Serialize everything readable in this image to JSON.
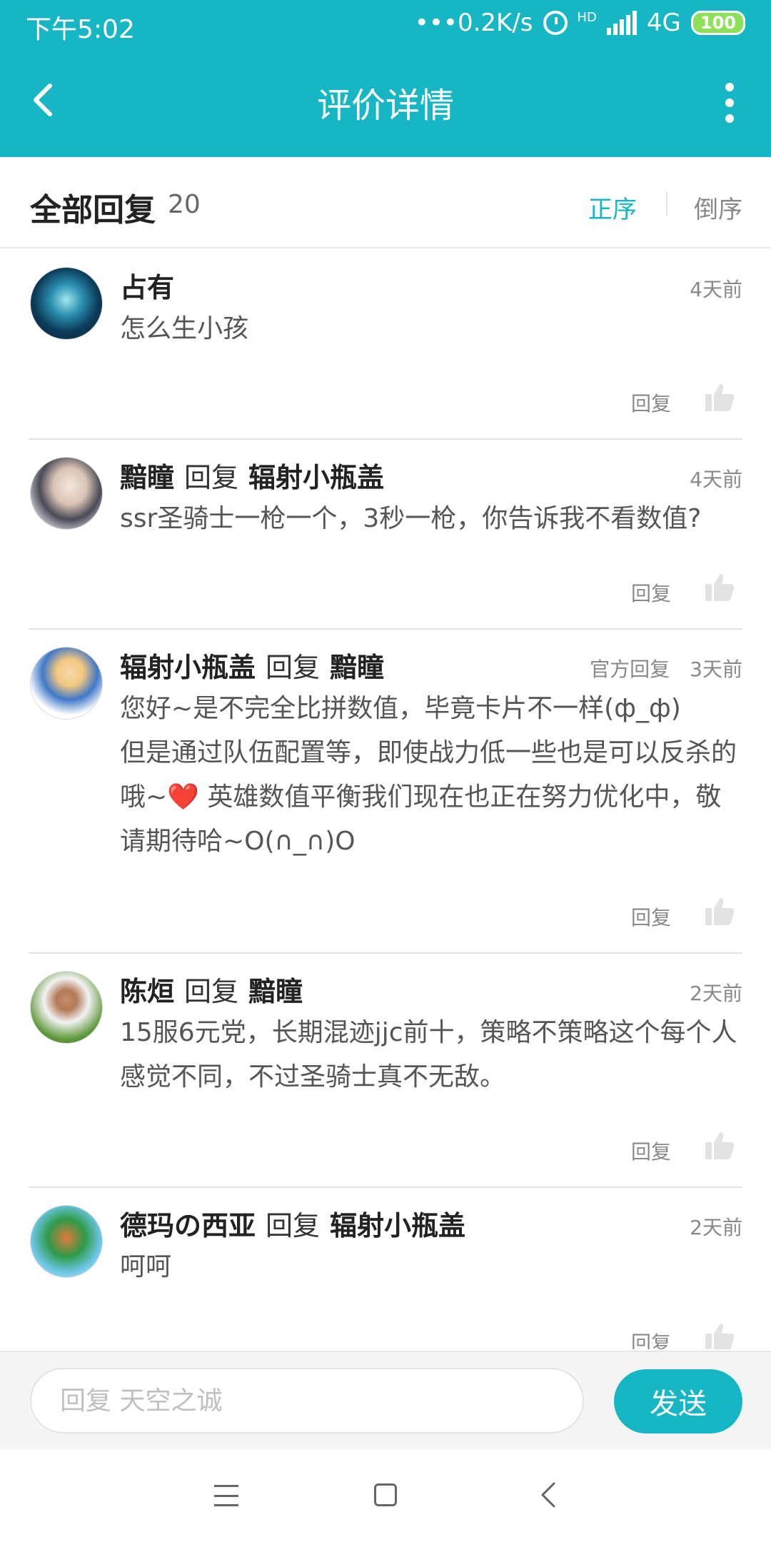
{
  "status_bar": {
    "time": "下午5:02",
    "network_speed": "•••0.2K/s",
    "hd_label": "HD",
    "network_type": "4G",
    "battery": "100"
  },
  "header": {
    "title": "评价详情"
  },
  "section": {
    "title": "全部回复",
    "count": "20",
    "sort_asc": "正序",
    "sort_desc": "倒序"
  },
  "comments": [
    {
      "author": "占有",
      "reply_word": "",
      "target": "",
      "official": "",
      "time": "4天前",
      "text": "怎么生小孩",
      "reply_label": "回复"
    },
    {
      "author": "黯瞳",
      "reply_word": "回复",
      "target": "辐射小瓶盖",
      "official": "",
      "time": "4天前",
      "text": "ssr圣骑士一枪一个，3秒一枪，你告诉我不看数值?",
      "reply_label": "回复"
    },
    {
      "author": "辐射小瓶盖",
      "reply_word": "回复",
      "target": "黯瞳",
      "official": "官方回复",
      "time": "3天前",
      "text": "您好~是不完全比拼数值，毕竟卡片不一样(ф_ф)\n但是通过队伍配置等，即使战力低一些也是可以反杀的哦~❤️ 英雄数值平衡我们现在也正在努力优化中，敬请期待哈~O(∩_∩)O",
      "reply_label": "回复"
    },
    {
      "author": "陈烜",
      "reply_word": "回复",
      "target": "黯瞳",
      "official": "",
      "time": "2天前",
      "text": "15服6元党，长期混迹jjc前十，策略不策略这个每个人感觉不同，不过圣骑士真不无敌。",
      "reply_label": "回复"
    },
    {
      "author": "德玛の西亚",
      "reply_word": "回复",
      "target": "辐射小瓶盖",
      "official": "",
      "time": "2天前",
      "text": "呵呵",
      "reply_label": "回复"
    }
  ],
  "input": {
    "placeholder": "回复 天空之诚",
    "send_label": "发送"
  },
  "colors": {
    "accent": "#17b6c4",
    "battery": "#8ee05a"
  }
}
